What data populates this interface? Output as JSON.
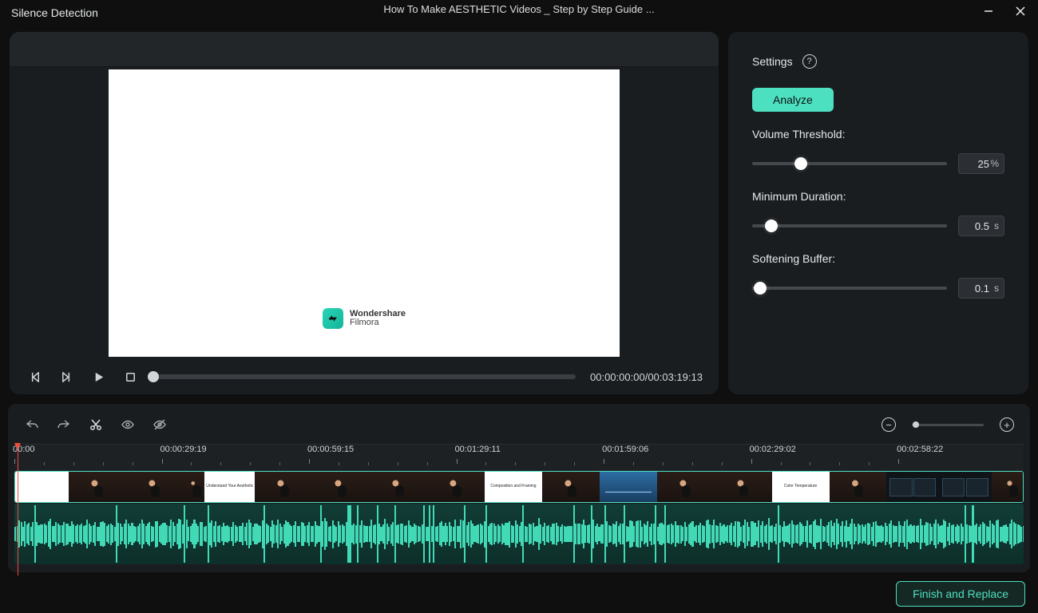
{
  "titlebar": {
    "app_title": "Silence Detection",
    "document_title": "How To Make AESTHETIC Videos _ Step by Step Guide ..."
  },
  "preview": {
    "brand_line1": "Wondershare",
    "brand_line2": "Filmora"
  },
  "transport": {
    "timecode_current": "00:00:00:00",
    "timecode_total": "00:03:19:13"
  },
  "settings": {
    "heading": "Settings",
    "analyze_label": "Analyze",
    "volume_threshold": {
      "label": "Volume Threshold:",
      "value": "25",
      "unit": "%",
      "percent": 25
    },
    "minimum_duration": {
      "label": "Minimum Duration:",
      "value": "0.5",
      "unit": "s",
      "percent": 10
    },
    "softening_buffer": {
      "label": "Softening Buffer:",
      "value": "0.1",
      "unit": "s",
      "percent": 4
    }
  },
  "timeline": {
    "ruler_labels": [
      "00:00",
      "00:00:29:19",
      "00:00:59:15",
      "00:01:29:11",
      "00:01:59:06",
      "00:02:29:02",
      "00:02:58:22"
    ],
    "clip_captions": {
      "white1": "",
      "white2": "Understand Your Aesthetic",
      "white3": "Composition and Framing",
      "white4": "Color Temperature"
    }
  },
  "footer": {
    "finish_label": "Finish and Replace"
  },
  "icons": {
    "minimize": "minimize-icon",
    "close": "close-icon",
    "help": "?",
    "zoom_out": "−",
    "zoom_in": "+"
  }
}
